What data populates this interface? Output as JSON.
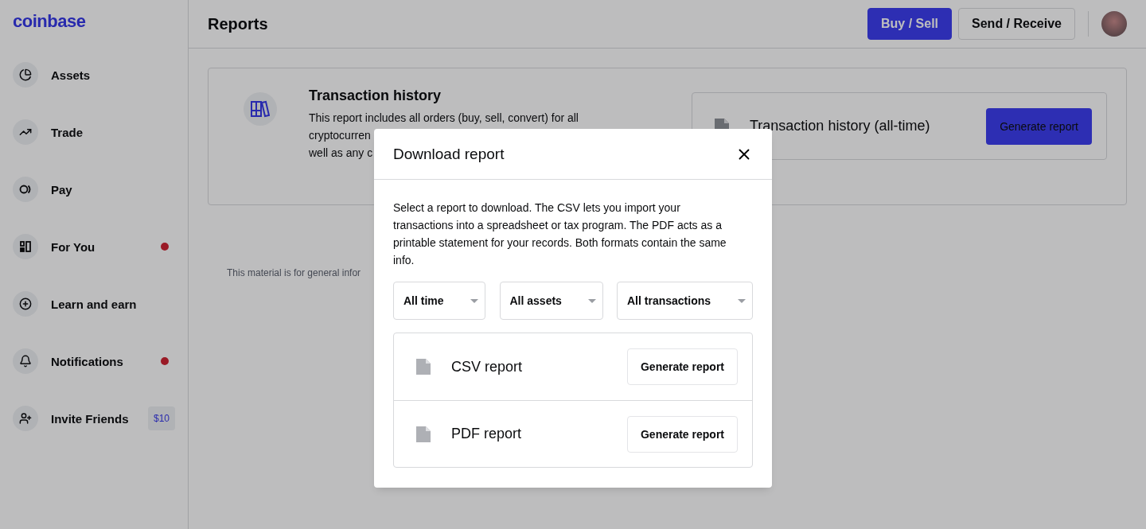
{
  "brand": "coinbase",
  "sidebar": {
    "items": [
      {
        "label": "Assets",
        "dot": false
      },
      {
        "label": "Trade",
        "dot": false
      },
      {
        "label": "Pay",
        "dot": false
      },
      {
        "label": "For You",
        "dot": true
      },
      {
        "label": "Learn and earn",
        "dot": false
      },
      {
        "label": "Notifications",
        "dot": true
      },
      {
        "label": "Invite Friends",
        "dot": false,
        "badge": "$10"
      }
    ]
  },
  "header": {
    "title": "Reports",
    "buttons": [
      {
        "label": "Buy / Sell",
        "kind": "primary"
      },
      {
        "label": "Send / Receive",
        "kind": "secondary"
      }
    ]
  },
  "report_card": {
    "title": "Transaction history",
    "description_lines": [
      "This report includes all orders (buy, sell, convert) for all",
      "cryptocurren",
      "well as any c"
    ],
    "item": {
      "label": "Transaction history (all-time)",
      "button": "Generate report"
    }
  },
  "footnote": "This material is for general infor",
  "dialog": {
    "title": "Download report",
    "body": "Select a report to download. The CSV lets you import your transactions into a spreadsheet or tax program. The PDF acts as a printable statement for your records. Both formats contain the same info.",
    "filters": [
      {
        "value": "All time"
      },
      {
        "value": "All assets"
      },
      {
        "value": "All transactions"
      }
    ],
    "reports": [
      {
        "label": "CSV report",
        "button": "Generate report"
      },
      {
        "label": "PDF report",
        "button": "Generate report"
      }
    ]
  }
}
